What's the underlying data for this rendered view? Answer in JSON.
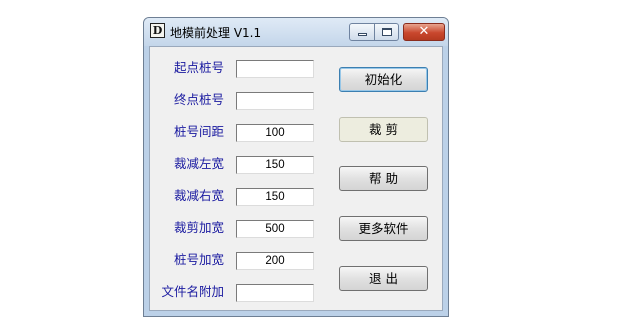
{
  "window": {
    "icon_letter": "D",
    "title": "地模前处理 V1.1",
    "close_glyph": "✕"
  },
  "form": {
    "fields": [
      {
        "label": "起点桩号",
        "value": ""
      },
      {
        "label": "终点桩号",
        "value": ""
      },
      {
        "label": "桩号间距",
        "value": "100"
      },
      {
        "label": "裁减左宽",
        "value": "150"
      },
      {
        "label": "裁减右宽",
        "value": "150"
      },
      {
        "label": "裁剪加宽",
        "value": "500"
      },
      {
        "label": "桩号加宽",
        "value": "200"
      },
      {
        "label": "文件名附加",
        "value": ""
      }
    ]
  },
  "buttons": {
    "init": "初始化",
    "crop": "裁 剪",
    "help": "帮 助",
    "more": "更多软件",
    "exit": "退 出"
  }
}
